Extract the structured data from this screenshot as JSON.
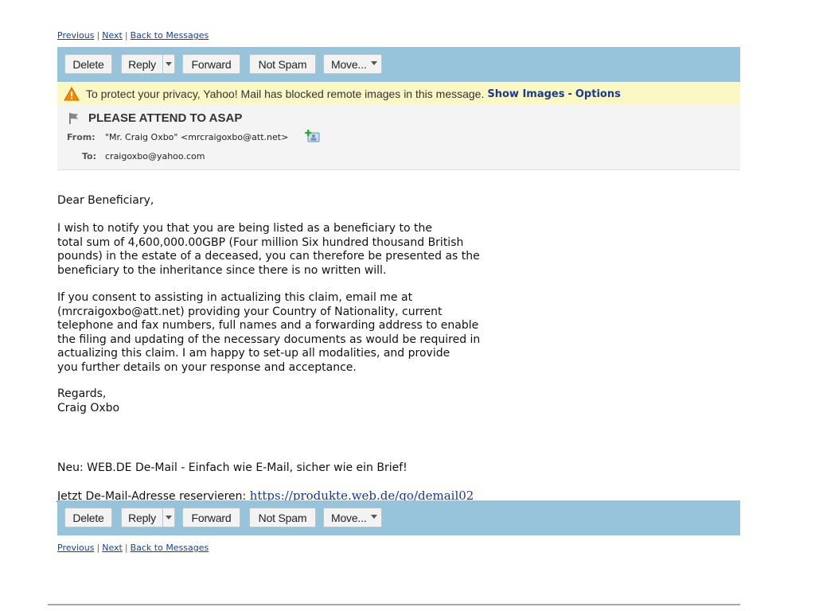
{
  "nav": {
    "previous": "Previous",
    "next": "Next",
    "back": "Back to Messages",
    "separator": "|"
  },
  "toolbar": {
    "delete": "Delete",
    "reply": "Reply",
    "forward": "Forward",
    "not_spam": "Not Spam",
    "move": "Move..."
  },
  "privacy": {
    "message": "To protect your privacy, Yahoo! Mail has blocked remote images in this message.",
    "show_images": "Show Images",
    "dash": "-",
    "options": "Options"
  },
  "message": {
    "subject": "PLEASE ATTEND TO ASAP",
    "from_label": "From:",
    "from_value": "\"Mr. Craig Oxbo\" <mrcraigoxbo@att.net>",
    "to_label": "To:",
    "to_value": "craigoxbo@yahoo.com"
  },
  "body": {
    "greeting": "Dear  Beneficiary,",
    "paragraph1": "I wish to notify you that you are being listed as a beneficiary to the\ntotal sum of 4,600,000.00GBP (Four million Six hundred thousand British\npounds) in the estate of a deceased, you can therefore be presented as the\nbeneficiary to the inheritance since there is no written will.",
    "paragraph2": "If you consent to assisting in actualizing this claim, email me at\n(mrcraigoxbo@att.net) providing your Country of Nationality, current\ntelephone and fax numbers, full names and a forwarding address to enable\nthe filing and updating of the necessary documents as would be required in\nactualizing this claim.  I am happy to set-up all modalities, and provide\nyou further details on your response and acceptance.",
    "regards": "Regards,\nCraig Oxbo",
    "webde_line1": "Neu: WEB.DE De-Mail - Einfach wie E-Mail, sicher wie ein Brief!",
    "webde_line2_prefix": "Jetzt De-Mail-Adresse reservieren: ",
    "webde_link": "https://produkte.web.de/go/demail02"
  },
  "colors": {
    "toolbar_bg": "#97c4da",
    "privacy_bg": "#fbf8c6",
    "link": "#1a3a8a"
  },
  "icons": [
    "warning-icon",
    "flag-icon",
    "add-contact-icon",
    "chevron-down-icon"
  ]
}
